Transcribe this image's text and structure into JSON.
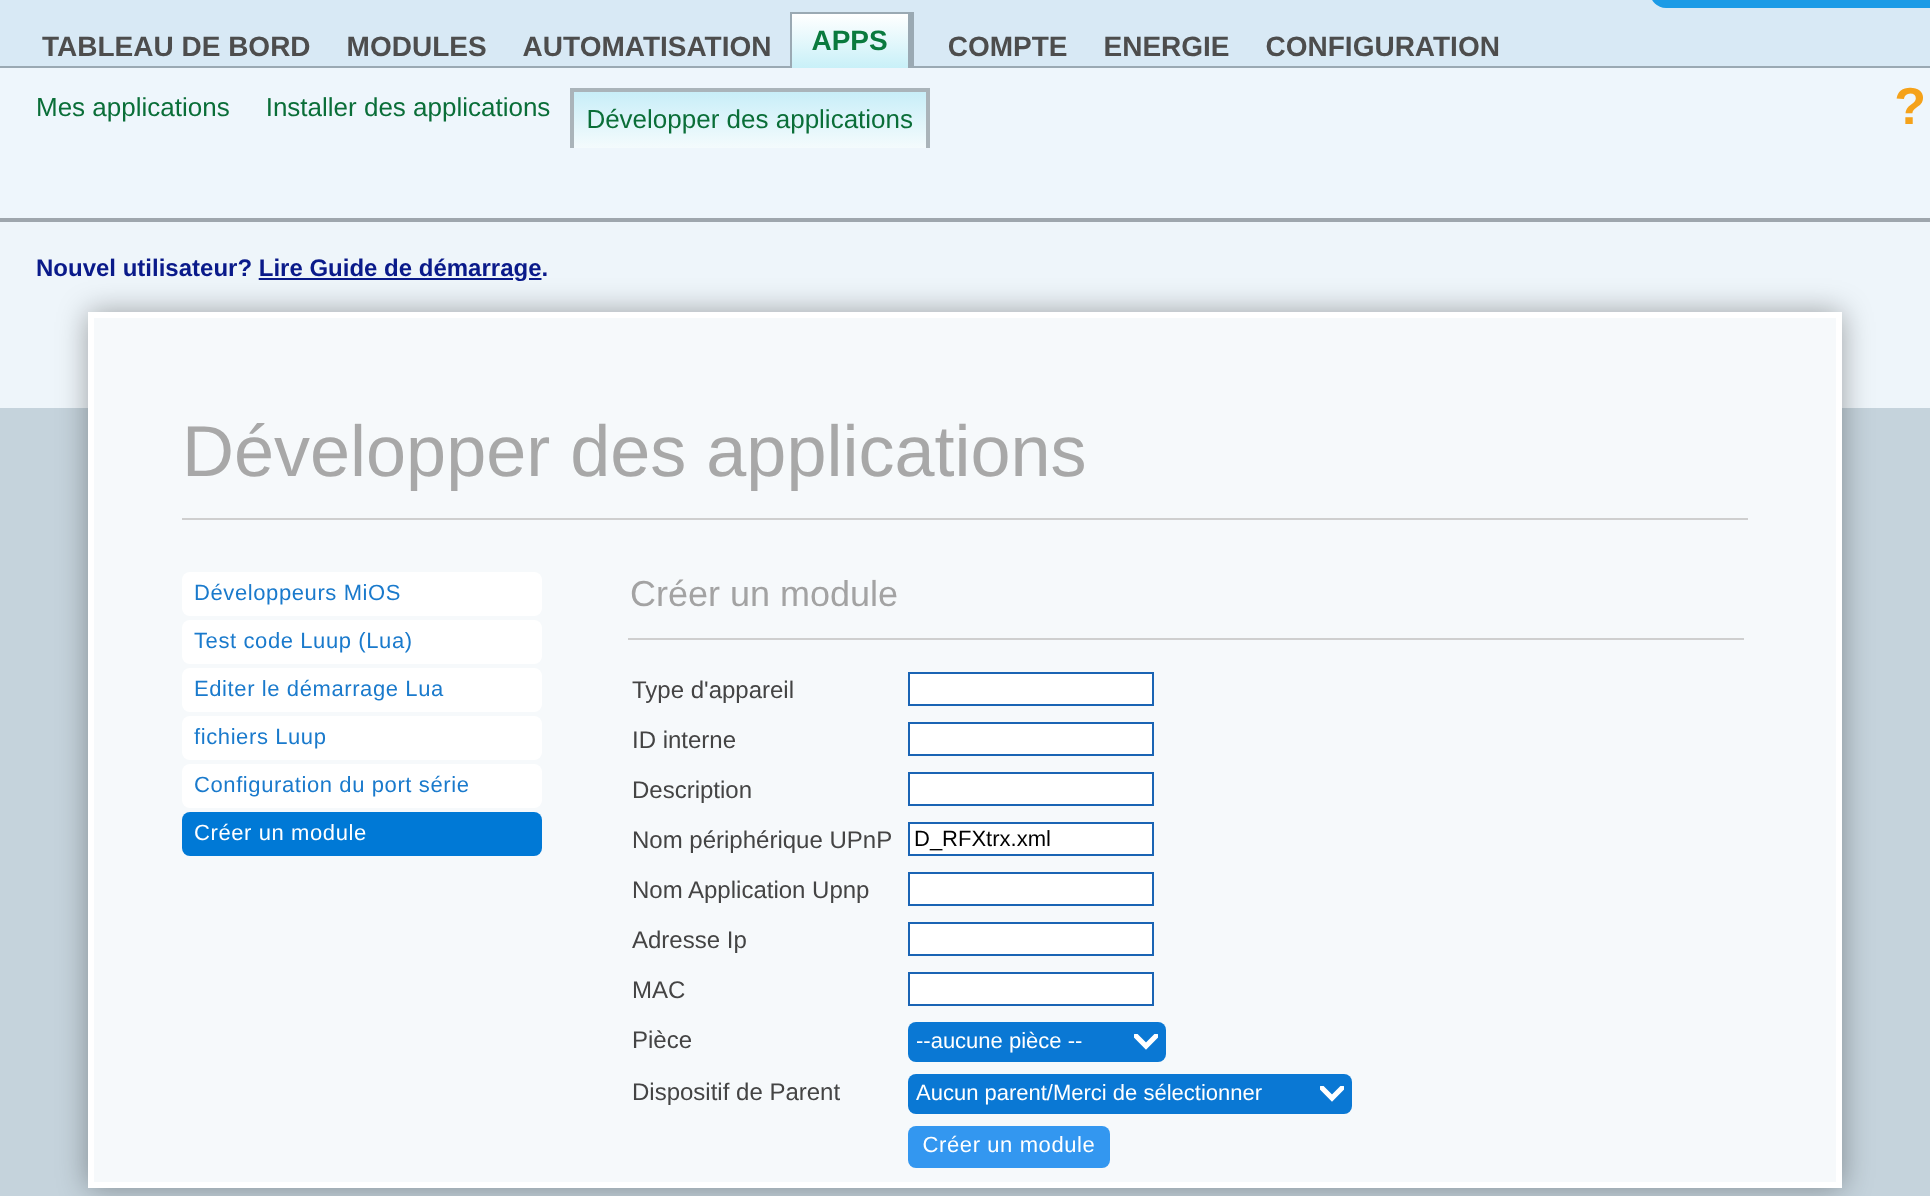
{
  "main_tabs": [
    {
      "label": "TABLEAU DE BORD",
      "selected": false
    },
    {
      "label": "MODULES",
      "selected": false
    },
    {
      "label": "AUTOMATISATION",
      "selected": false
    },
    {
      "label": "APPS",
      "selected": true
    },
    {
      "label": "COMPTE",
      "selected": false
    },
    {
      "label": "ENERGIE",
      "selected": false
    },
    {
      "label": "CONFIGURATION",
      "selected": false
    }
  ],
  "sub_tabs": [
    {
      "label": "Mes applications",
      "selected": false
    },
    {
      "label": "Installer des applications",
      "selected": false
    },
    {
      "label": "Développer des applications",
      "selected": true
    }
  ],
  "help": "?",
  "notice": {
    "text": "Nouvel utilisateur?",
    "link": "Lire Guide de démarrage",
    "end": "."
  },
  "page_title": "Développer des applications",
  "sidebar": {
    "items": [
      {
        "label": "Développeurs MiOS",
        "selected": false
      },
      {
        "label": "Test code Luup (Lua)",
        "selected": false
      },
      {
        "label": "Editer le démarrage Lua",
        "selected": false
      },
      {
        "label": "fichiers Luup",
        "selected": false
      },
      {
        "label": "Configuration du port série",
        "selected": false
      },
      {
        "label": "Créer un module",
        "selected": true
      }
    ]
  },
  "form": {
    "title": "Créer un module",
    "fields": [
      {
        "kind": "text",
        "label": "Type d'appareil"
      },
      {
        "kind": "text",
        "label": "ID interne"
      },
      {
        "kind": "text",
        "label": "Description"
      },
      {
        "kind": "text",
        "label": "Nom périphérique UPnP",
        "value": "D_RFXtrx.xml"
      },
      {
        "kind": "text",
        "label": "Nom Application Upnp"
      },
      {
        "kind": "text",
        "label": "Adresse Ip"
      },
      {
        "kind": "text",
        "label": "MAC"
      },
      {
        "kind": "select",
        "label": "Pièce",
        "value": "--aucune pièce --"
      },
      {
        "kind": "select",
        "label": "Dispositif de Parent",
        "value": "Aucun parent/Merci de sélectionner",
        "wide": true
      }
    ],
    "submit": "Créer un module"
  }
}
